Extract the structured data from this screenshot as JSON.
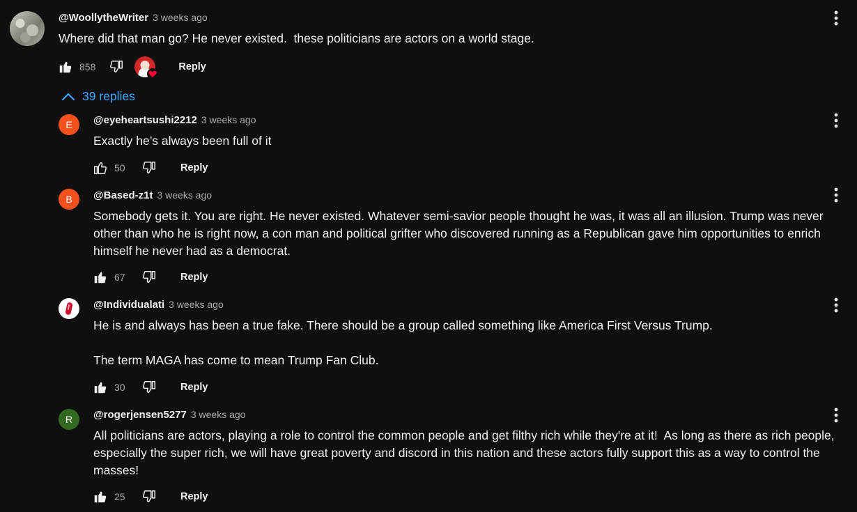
{
  "colors": {
    "background": "#0f0f0f",
    "link_blue": "#3ea6ff",
    "avatar_e": "#f4511e",
    "avatar_b": "#f4511e",
    "avatar_r": "#33691e",
    "heart": "#ff0033"
  },
  "main_comment": {
    "handle": "@WoollytheWriter",
    "time": "3 weeks ago",
    "text": "Where did that man go? He never existed.  these politicians are actors on a world stage.",
    "likes": "858",
    "reply_label": "Reply",
    "avatar_icon": "user-photo-avatar",
    "creator_heart_icon": "creator-heart-icon"
  },
  "replies_toggle": {
    "label": "39 replies",
    "icon": "chevron-up-icon"
  },
  "replies": [
    {
      "initial": "E",
      "handle": "@eyeheartsushi2212",
      "time": "3 weeks ago",
      "text": "Exactly he’s always been full of it",
      "likes": "50",
      "reply_label": "Reply"
    },
    {
      "initial": "B",
      "handle": "@Based-z1t",
      "time": "3 weeks ago",
      "text": "Somebody gets it. You are right. He never existed. Whatever semi-savior people thought he was, it was all an illusion. Trump was never other than who he is right now, a con man and political grifter who discovered running as a Republican gave him opportunities to enrich himself he never had as a democrat.",
      "likes": "67",
      "reply_label": "Reply"
    },
    {
      "initial": "",
      "handle": "@Individualati",
      "time": "3 weeks ago",
      "text": "He is and always has been a true fake. There should be a group called something like America First Versus Trump.\n\nThe term MAGA has come to mean Trump Fan Club.",
      "likes": "30",
      "reply_label": "Reply"
    },
    {
      "initial": "R",
      "handle": "@rogerjensen5277",
      "time": "3 weeks ago",
      "text": "All politicians are actors, playing a role to control the common people and get filthy rich while they're at it!  As long as there as rich people, especially the super rich, we will have great poverty and discord in this nation and these actors fully support this as a way to control the masses!",
      "likes": "25",
      "reply_label": "Reply"
    }
  ]
}
